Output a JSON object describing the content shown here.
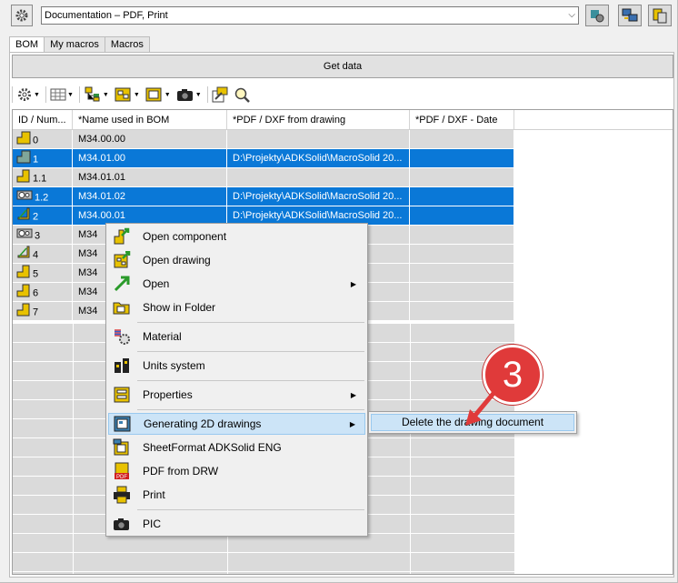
{
  "top": {
    "preset_value": "Documentation – PDF, Print",
    "icons": [
      "gear-icon",
      "assembly-gear-icon",
      "computer-transfer-icon",
      "clipboard-copy-icon"
    ]
  },
  "tabs": [
    {
      "label": "BOM",
      "active": true
    },
    {
      "label": "My macros",
      "active": false
    },
    {
      "label": "Macros",
      "active": false
    }
  ],
  "get_data_label": "Get data",
  "toolbar_icons": [
    "settings-gear-icon",
    "table-icon",
    "tree-structure-icon",
    "drawing-icon",
    "drawing-frame-icon",
    "camera-icon",
    "open-external-icon",
    "search-zoom-icon"
  ],
  "grid": {
    "headers": [
      "ID / Num...",
      "*Name used in BOM",
      "*PDF / DXF from drawing",
      "*PDF / DXF - Date"
    ],
    "rows": [
      {
        "id": "0",
        "name": "M34.00.00",
        "pdf": "",
        "date": "",
        "selected": false,
        "icon": "assembly-icon"
      },
      {
        "id": "1",
        "name": "M34.01.00",
        "pdf": "D:\\Projekty\\ADKSolid\\MacroSolid 20...",
        "date": "",
        "selected": true,
        "icon": "assembly-icon"
      },
      {
        "id": "1.1",
        "name": "M34.01.01",
        "pdf": "",
        "date": "",
        "selected": false,
        "icon": "part-icon"
      },
      {
        "id": "1.2",
        "name": "M34.01.02",
        "pdf": "D:\\Projekty\\ADKSolid\\MacroSolid 20...",
        "date": "",
        "selected": true,
        "icon": "toolbox-part-icon"
      },
      {
        "id": "2",
        "name": "M34.00.01",
        "pdf": "D:\\Projekty\\ADKSolid\\MacroSolid 20...",
        "date": "",
        "selected": true,
        "icon": "sheetmetal-part-icon"
      },
      {
        "id": "3",
        "name": "M34",
        "pdf": "",
        "date": "",
        "selected": false,
        "icon": "toolbox-part-icon"
      },
      {
        "id": "4",
        "name": "M34",
        "pdf": "",
        "date": "",
        "selected": false,
        "icon": "sheetmetal-part-icon"
      },
      {
        "id": "5",
        "name": "M34",
        "pdf": "",
        "date": "",
        "selected": false,
        "icon": "part-icon"
      },
      {
        "id": "6",
        "name": "M34",
        "pdf": "",
        "date": "",
        "selected": false,
        "icon": "part-icon"
      },
      {
        "id": "7",
        "name": "M34",
        "pdf": "",
        "date": "",
        "selected": false,
        "icon": "part-icon"
      }
    ]
  },
  "context_menu": {
    "items": [
      {
        "label": "Open component",
        "icon": "open-component-icon",
        "submenu": false
      },
      {
        "label": "Open drawing",
        "icon": "open-drawing-icon",
        "submenu": false
      },
      {
        "label": "Open",
        "icon": "open-arrow-icon",
        "submenu": true
      },
      {
        "label": "Show in Folder",
        "icon": "folder-icon",
        "submenu": false
      },
      {
        "label": "Material",
        "icon": "material-icon",
        "submenu": false
      },
      {
        "label": "Units system",
        "icon": "units-icon",
        "submenu": false
      },
      {
        "label": "Properties",
        "icon": "properties-icon",
        "submenu": true
      },
      {
        "label": "Generating 2D drawings",
        "icon": "drawing-generate-icon",
        "submenu": true
      },
      {
        "label": "SheetFormat ADKSolid ENG",
        "icon": "sheetformat-icon",
        "submenu": false
      },
      {
        "label": "PDF from DRW",
        "icon": "pdf-icon",
        "submenu": false
      },
      {
        "label": "Print",
        "icon": "printer-icon",
        "submenu": false
      },
      {
        "label": "PIC",
        "icon": "camera-icon",
        "submenu": false
      }
    ]
  },
  "submenu": {
    "label": "Delete the drawing document"
  },
  "callout": {
    "number": "3",
    "color": "#e03a3a"
  },
  "colors": {
    "selection": "#0a78d7",
    "row_bg": "#dadada",
    "menu_highlight": "#cce4f7"
  }
}
